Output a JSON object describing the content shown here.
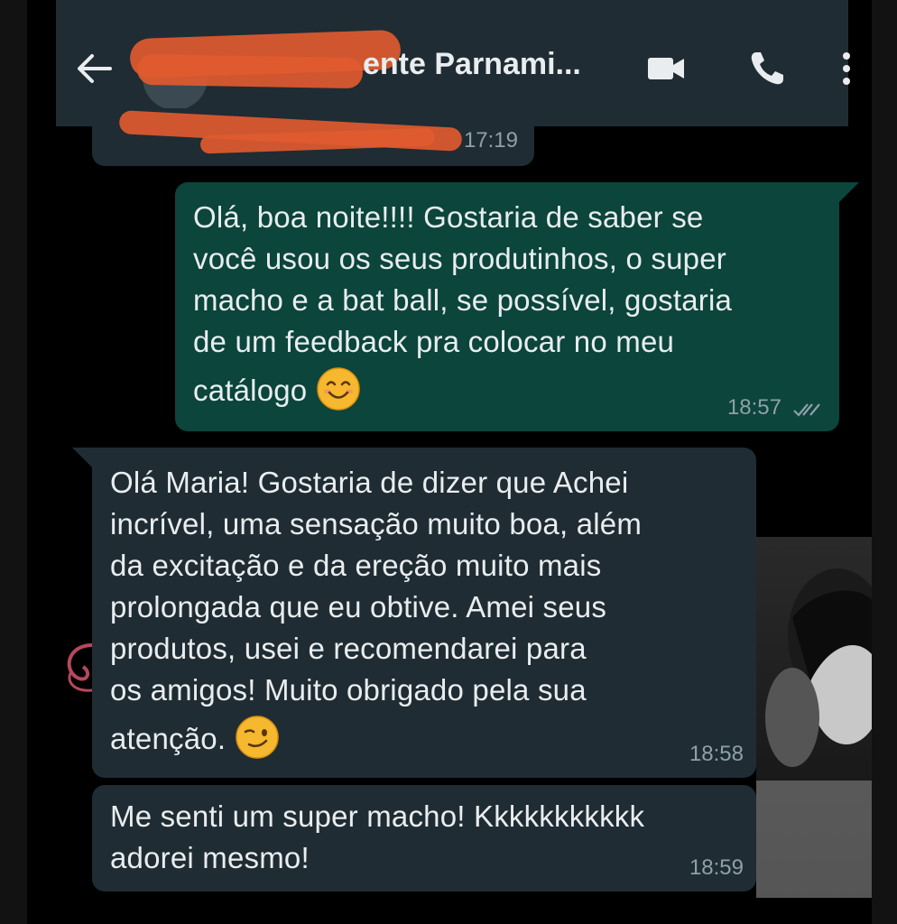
{
  "header": {
    "contact_name": "ente Parnami...",
    "icons": {
      "back": "back-arrow-icon",
      "video": "video-call-icon",
      "voice": "voice-call-icon",
      "menu": "more-options-icon"
    }
  },
  "messages": [
    {
      "direction": "incoming",
      "text": "",
      "time": "17:19"
    },
    {
      "direction": "outgoing",
      "lines": [
        "Olá, boa noite!!!! Gostaria de saber se",
        "você usou os seus produtinhos, o super",
        "macho e a bat ball, se possível, gostaria",
        "de um feedback pra colocar no meu",
        "catálogo"
      ],
      "emoji": "smiling-face-icon",
      "time": "18:57",
      "status": "read-checkmarks-icon"
    },
    {
      "direction": "incoming",
      "lines": [
        "Olá Maria! Gostaria de dizer que Achei",
        "incrível, uma sensação muito boa, além",
        "da excitação e da ereção muito mais",
        "prolongada que eu obtive. Amei seus",
        "produtos, usei e recomendarei para",
        "os amigos! Muito obrigado pela sua",
        "atenção."
      ],
      "emoji": "winking-face-icon",
      "time": "18:58"
    },
    {
      "direction": "incoming",
      "lines": [
        "Me senti um super macho! Kkkkkkkkkkk",
        "adorei mesmo!"
      ],
      "time": "18:59"
    }
  ],
  "colors": {
    "header_bg": "#1f2c33",
    "incoming_bg": "#1f2c33",
    "outgoing_bg": "#0b453c",
    "text": "#e9edef",
    "meta": "#8fa0a8",
    "redaction": "#e05a2f"
  }
}
